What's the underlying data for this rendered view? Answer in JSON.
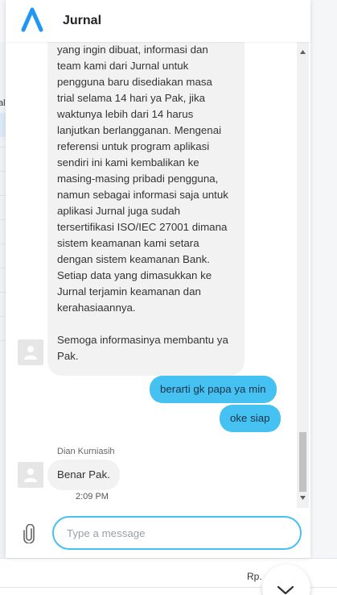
{
  "header": {
    "title": "Jurnal",
    "logo_icon": "jurnal-logo-icon"
  },
  "background": {
    "left_text": "al",
    "bottom_text": "Rp."
  },
  "messages": {
    "long_reply": {
      "lines": [
        "yang ingin dibuat, informasi dan",
        "team kami dari Jurnal untuk",
        "pengguna baru disediakan masa",
        "trial selama 14 hari ya Pak, jika",
        "waktunya lebih dari 14 harus",
        "lanjutkan berlangganan. Mengenai",
        "referensi untuk program aplikasi",
        "sendiri ini kami kembalikan ke",
        "masing-masing pribadi pengguna,",
        "namun sebagai informasi saja untuk",
        "aplikasi Jurnal juga sudah",
        "tersertifikasi ISO/IEC 27001 dimana",
        "sistem keamanan kami setara",
        "dengan sistem keamanan Bank.",
        "Setiap data yang dimasukkan ke",
        "Jurnal terjamin keamanan dan",
        "kerahasiaannya.",
        "",
        "Semoga informasinya membantu ya",
        "Pak."
      ]
    },
    "user_message_1": "berarti gk papa ya min",
    "user_message_2": "oke siap",
    "agent_name": "Dian Kurniasih",
    "agent_reply": "Benar Pak.",
    "agent_reply_time": "2:09 PM"
  },
  "composer": {
    "placeholder": "Type a message"
  },
  "colors": {
    "accent": "#45c1f2",
    "logo": "#2196f3",
    "bubble_in": "#f2f2f2"
  }
}
